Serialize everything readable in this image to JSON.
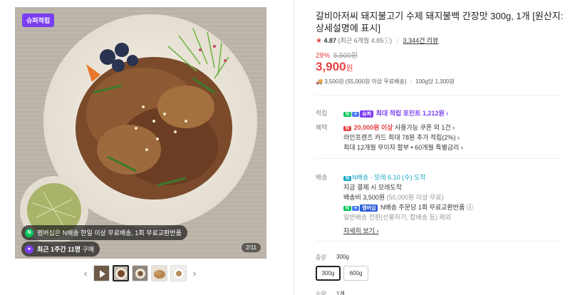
{
  "image": {
    "badge": "슈퍼적립",
    "member_text": "멤버십은 N배송 한일 이상 무료배송, 1회 무료교환반품",
    "recent_text_strong": "최근 1주간 11명",
    "recent_text": " 구매",
    "page_counter": "2/11"
  },
  "thumbnails": {
    "prev": "‹",
    "next": "›"
  },
  "product": {
    "title": "갈비아저씨 돼지불고기 수제 돼지불백 간장맛 300g, 1개 [원산지: 상세설명에 표시]",
    "rating_star": "★",
    "rating": "4.87",
    "rating_sub": "(최근 6개월 4.85ⓘ)",
    "reviews": "3,344건 리뷰",
    "discount_pct": "29%",
    "original_price": "5,500원",
    "price": "3,900",
    "price_unit": "원",
    "shipping_fee": "3,500원 (55,000원 이상 무료배송)",
    "unit_price": "100g당 1,300원"
  },
  "benefits": {
    "points_label": "적립",
    "points_text": "최대 적립 포인트 1,212원 ›",
    "benefit_label": "혜택",
    "coupon_strong": "20,000원 이상",
    "coupon_text": " 사용가능 쿠폰 외 1건 ›",
    "card_text": "라인프렌즈 카드 최대 78원 추가 적립(2%) ›",
    "installment_text": "최대 12개월 무이자 할부 • 60개월 특별금리 ›"
  },
  "delivery": {
    "label": "배송",
    "arrival_tag": "N배송",
    "arrival_text": "· 모레 6.10 (수) 도착",
    "order_text": "지금 결제 시 모레도착",
    "fee_text": "배송비 3,500원",
    "fee_note": " (55,000원 이상 무료)",
    "return_text": "N배송 주문당 1회 무료교환반품 ⓘ",
    "normal_text": "일반배송 전환(선물하기, 합배송 등) 제외",
    "detail_link": "자세히 보기 ›"
  },
  "options": {
    "label": "중량",
    "current": "300g",
    "choices": [
      "300g",
      "600g"
    ],
    "qty_label": "수량",
    "qty_value": "1개"
  },
  "colors": {
    "accent": "#e54040",
    "naver_green": "#03c75a",
    "purple": "#7b3ff2"
  }
}
